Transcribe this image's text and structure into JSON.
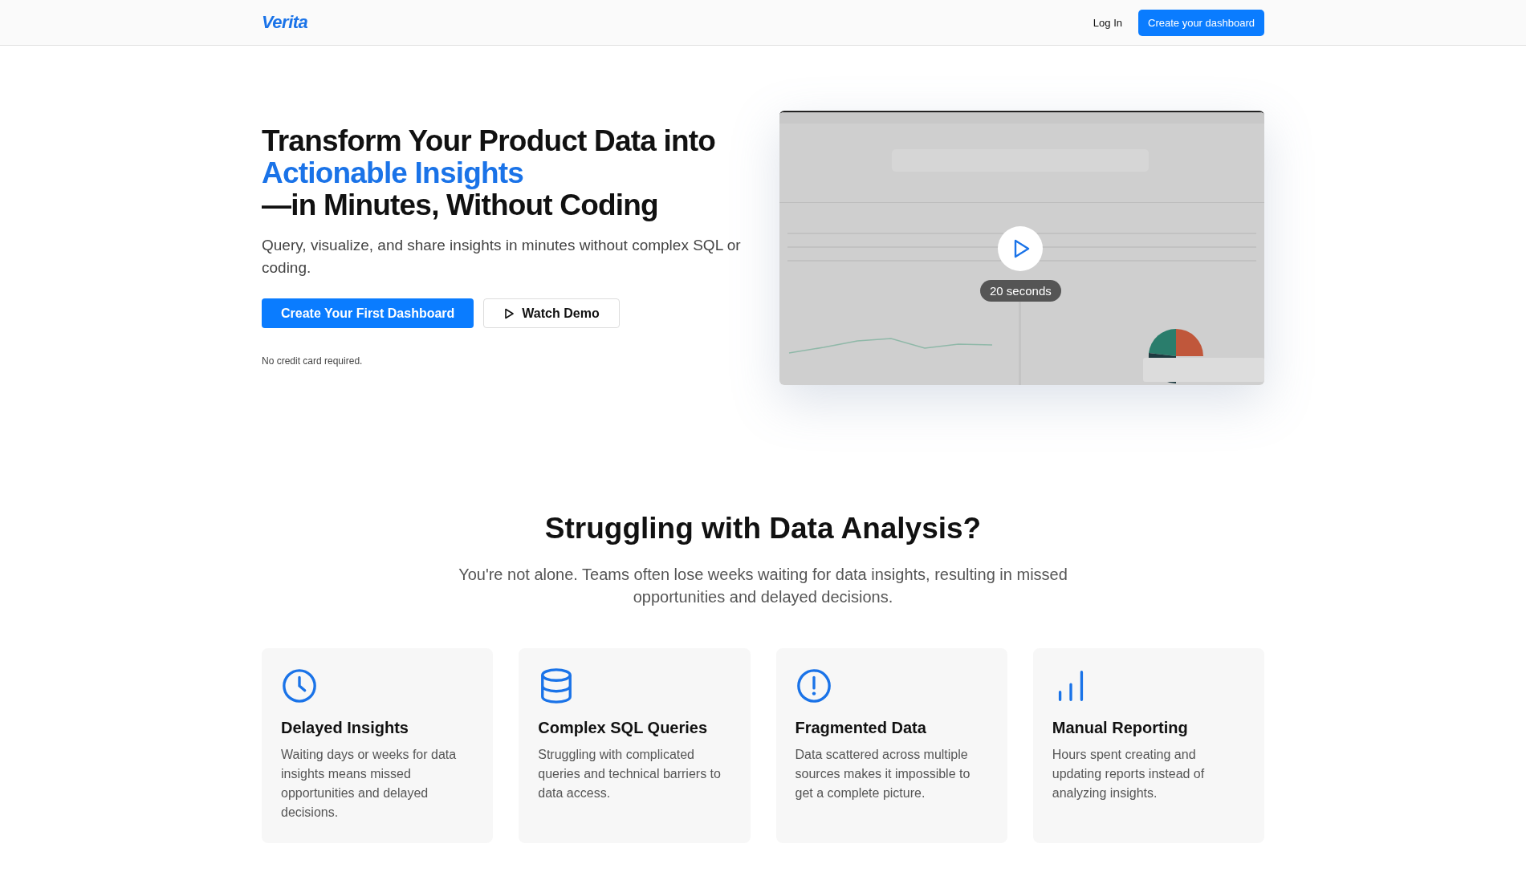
{
  "header": {
    "logo": "Verita",
    "login": "Log In",
    "cta": "Create your dashboard"
  },
  "hero": {
    "title_line1": "Transform Your Product Data into",
    "title_highlight": "Actionable Insights",
    "title_line3": "—in Minutes, Without Coding",
    "subtitle": "Query, visualize, and share insights in minutes without complex SQL or coding.",
    "primary_button": "Create Your First Dashboard",
    "secondary_button": "Watch Demo",
    "note": "No credit card required.",
    "video": {
      "kind": "picture",
      "duration": "20 seconds"
    }
  },
  "problems": {
    "title": "Struggling with Data Analysis?",
    "subtitle": "You're not alone. Teams often lose weeks waiting for data insights, resulting in missed opportunities and delayed decisions.",
    "cards": [
      {
        "kind": "clock",
        "title": "Delayed Insights",
        "text": "Waiting days or weeks for data insights means missed opportunities and delayed decisions."
      },
      {
        "kind": "database",
        "title": "Complex SQL Queries",
        "text": "Struggling with complicated queries and technical barriers to data access."
      },
      {
        "kind": "alert",
        "title": "Fragmented Data",
        "text": "Data scattered across multiple sources makes it impossible to get a complete picture."
      },
      {
        "kind": "bars",
        "title": "Manual Reporting",
        "text": "Hours spent creating and updating reports instead of analyzing insights."
      }
    ]
  }
}
